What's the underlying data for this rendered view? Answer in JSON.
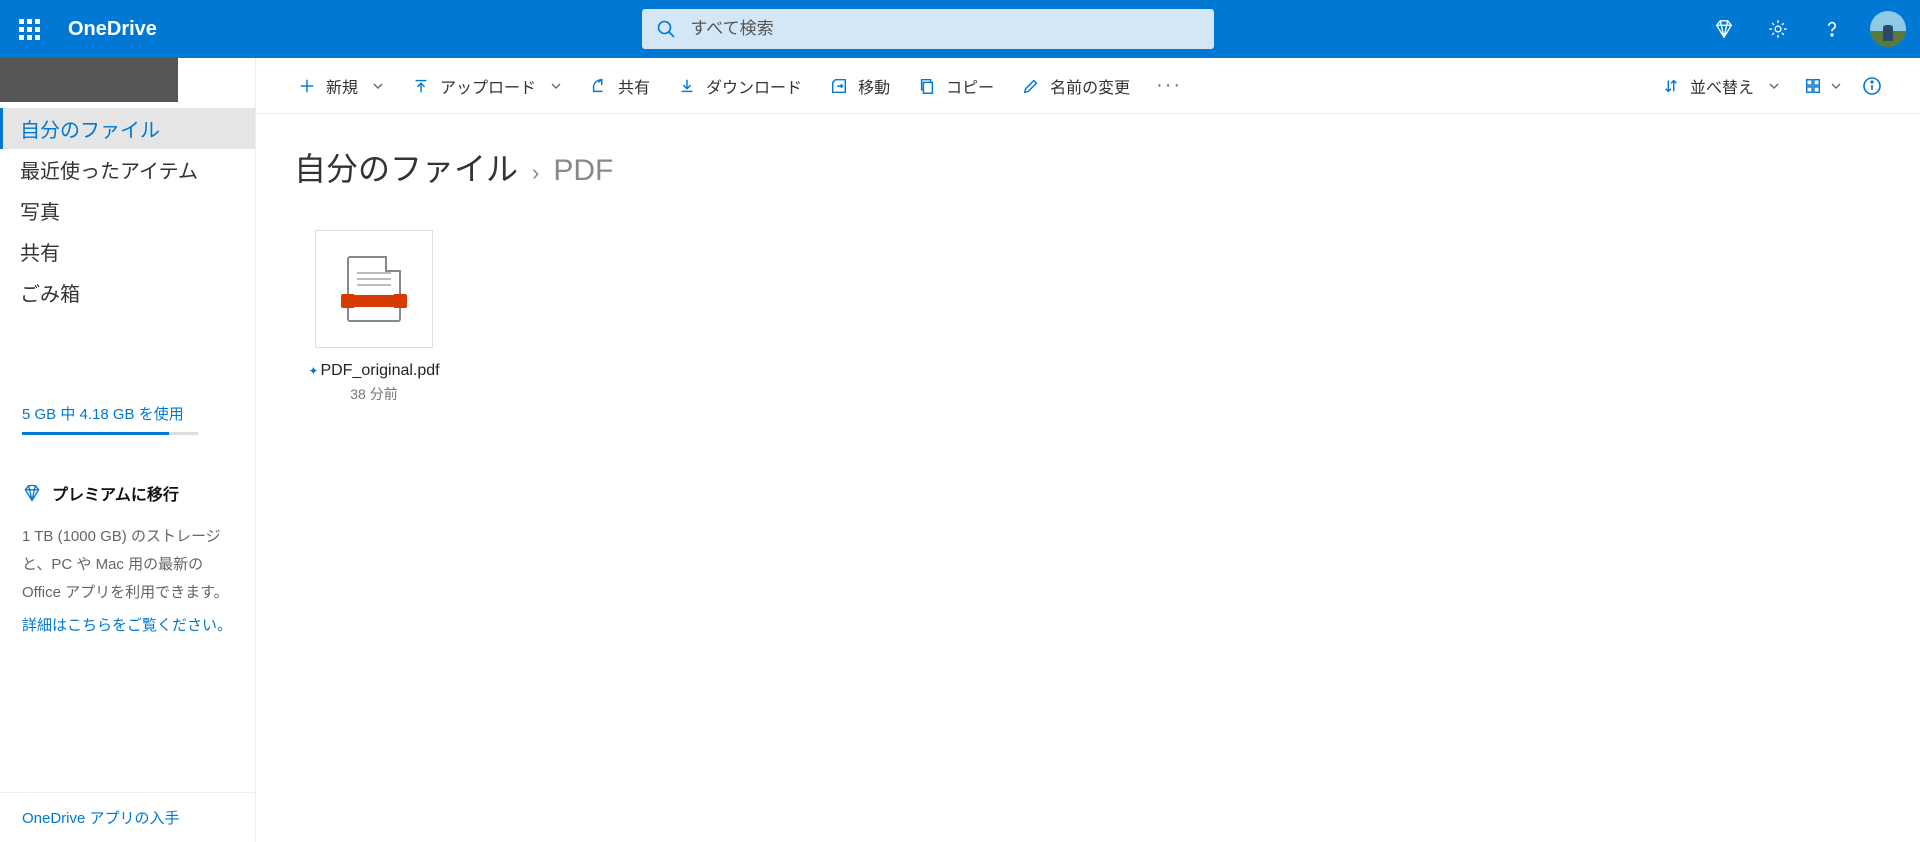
{
  "brand": "OneDrive",
  "search": {
    "placeholder": "すべて検索"
  },
  "sidebar": {
    "items": [
      {
        "label": "自分のファイル",
        "active": true
      },
      {
        "label": "最近使ったアイテム"
      },
      {
        "label": "写真"
      },
      {
        "label": "共有"
      },
      {
        "label": "ごみ箱"
      }
    ],
    "storage_text": "5 GB 中 4.18 GB を使用",
    "storage_pct": 83.6,
    "premium_title": "プレミアムに移行",
    "premium_desc": "1 TB (1000 GB) のストレージと、PC や Mac 用の最新の Office アプリを利用できます。",
    "premium_link": "詳細はこちらをご覧ください。",
    "app_link": "OneDrive アプリの入手"
  },
  "toolbar": {
    "new": "新規",
    "upload": "アップロード",
    "share": "共有",
    "download": "ダウンロード",
    "move": "移動",
    "copy": "コピー",
    "rename": "名前の変更",
    "sort": "並べ替え"
  },
  "breadcrumb": {
    "root": "自分のファイル",
    "current": "PDF"
  },
  "files": [
    {
      "name": "PDF_original.pdf",
      "time": "38 分前"
    }
  ]
}
